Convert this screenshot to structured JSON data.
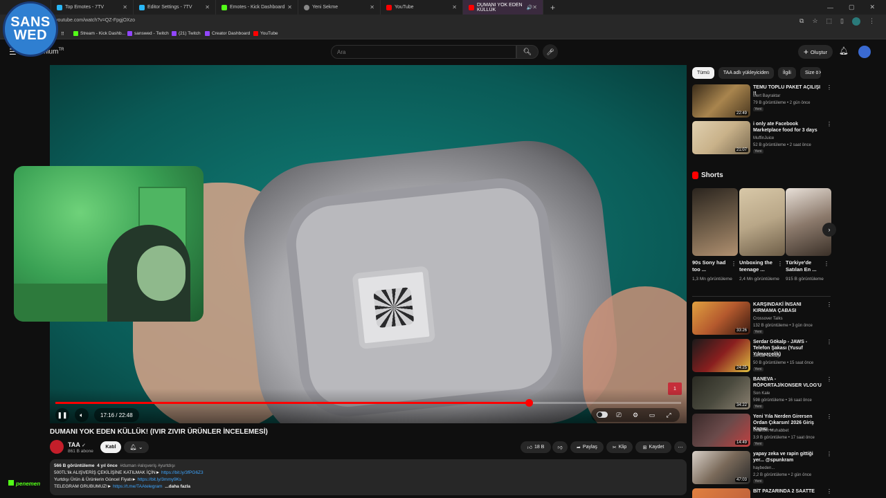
{
  "browser": {
    "tabs": [
      {
        "label": "Top Emotes - 7TV",
        "color": "#29b6f6"
      },
      {
        "label": "Editor Settings - 7TV",
        "color": "#29b6f6"
      },
      {
        "label": "Emotes - Kick Dashboard",
        "color": "#53fc18"
      },
      {
        "label": "Yeni Sekme",
        "color": "#888888"
      },
      {
        "label": "YouTube",
        "color": "#ff0000"
      },
      {
        "label": "DUMANI YOK EDEN KÜLLÜK",
        "color": "#ff0000"
      }
    ],
    "url": "youtube.com/watch?v=QZ-FpgjOXzo",
    "bookmarks": [
      {
        "label": "Stream - Kick Dashb...",
        "color": "#53fc18"
      },
      {
        "label": "sanswed - Twitch",
        "color": "#9146ff"
      },
      {
        "label": "(21) Twitch",
        "color": "#9146ff"
      },
      {
        "label": "Creator Dashboard",
        "color": "#9146ff"
      },
      {
        "label": "YouTube",
        "color": "#ff0000"
      }
    ]
  },
  "overlay_logo": {
    "line1": "SANS",
    "line2": "WED"
  },
  "masthead": {
    "logo_text": "mium",
    "logo_sup": "TR",
    "search_placeholder": "Ara",
    "create_label": "Oluştur"
  },
  "player": {
    "time": "17:16 / 22:48",
    "progress_fraction": 0.757,
    "badge": "1"
  },
  "video": {
    "title": "DUMANI YOK EDEN KÜLLÜK! (IVIR ZIVIR ÜRÜNLER İNCELEMESİ)",
    "channel": "TAA",
    "subscribers": "861 B abone",
    "join_label": "Katıl",
    "like_count": "18 B",
    "share_label": "Paylaş",
    "clip_label": "Klip",
    "save_label": "Kaydet"
  },
  "description": {
    "views": "566 B görüntüleme",
    "age": "4 yıl önce",
    "tags": "#duman #alışveriş #yurtdışı",
    "line2_text": "500TL'lik ALIŞVERİŞ ÇEKİLİŞİNE KATILMAK İÇİN►",
    "line2_link": "https://bit.ly/3fPG6Z3",
    "line3_text": "Yurtdışı Ürün & Ürünlerin Güncel Fiyatı►",
    "line3_link": "https://bit.ly/3mmy9Ks",
    "line4_text": "TELEGRAM GRUBUMUZ!►",
    "line4_link": "https://t.me/TAAtelegram",
    "more": "...daha fazla"
  },
  "kick_bug": "penemen",
  "chips": [
    "Tümü",
    "TAA adlı yükleyiciden",
    "İlgili",
    "Size ö"
  ],
  "recommendations_top": [
    {
      "title": "TEMU TOPLU PAKET AÇILIŞI !!",
      "channel": "Mert Bayraktar",
      "meta": "79 B görüntüleme • 2 gün önce",
      "badge": "Yeni",
      "duration": "22:49",
      "color": "#8a6a3e"
    },
    {
      "title": "i only ate Facebook Marketplace food for 3 days",
      "channel": "MuffinJuice",
      "meta": "52 B görüntüleme • 2 saat önce",
      "badge": "Yeni",
      "duration": "21:07",
      "color": "#c9b28a"
    }
  ],
  "shorts": {
    "heading": "Shorts",
    "items": [
      {
        "title": "90s Sony had too ...",
        "views": "1,3 Mn görüntüleme",
        "color": "#6b5a46"
      },
      {
        "title": "Unboxing the teenage ...",
        "views": "2,4 Mn görüntüleme",
        "color": "#b9a788"
      },
      {
        "title": "Türkiye'de Satılan En ...",
        "views": "915 B görüntüleme",
        "color": "#8c7a6c"
      }
    ]
  },
  "recommendations_bottom": [
    {
      "title": "KARŞINDAKİ İNSANI KIRMAMA ÇABASI",
      "channel": "Crossover Talks",
      "meta": "132 B görüntüleme • 3 gün önce",
      "badge": "Yeni",
      "duration": "33:26",
      "color": "#b55a2e"
    },
    {
      "title": "Serdar Gökalp - JAWS - Telefon Şakası (Yusuf Yılmazçelik)",
      "channel": "Serdar Gökalp",
      "meta": "50 B görüntüleme • 15 saat önce",
      "badge": "Yeni",
      "duration": "24:25",
      "color": "#8a1f1f"
    },
    {
      "title": "BANEVA - RÖPORTAJ/KONSER VLOG'U",
      "channel": "Son Kale",
      "meta": "598 görüntüleme • 16 saat önce",
      "badge": "Yeni",
      "duration": "34:22",
      "color": "#4a4a3e"
    },
    {
      "title": "Yeni Yıla Nerden Girersen Ordan Çıkarsın! 2026 Giriş Kapısı ...",
      "channel": "Mücebet Muhabbet",
      "meta": "3,9 B görüntüleme • 17 saat önce",
      "badge": "Yeni",
      "duration": "14:49",
      "color": "#6a4a4a"
    },
    {
      "title": "yapay zeka ve rapin gittiği yer... @spunkram",
      "channel": "haybeden...",
      "meta": "2,2 B görüntüleme • 2 gün önce",
      "badge": "Yeni",
      "duration": "47:03",
      "color": "#7a6a5a"
    },
    {
      "title": "BİT PAZARINDA 2 SAATTE",
      "channel": "",
      "meta": "",
      "badge": "",
      "duration": "",
      "color": "#b85a3a"
    }
  ]
}
